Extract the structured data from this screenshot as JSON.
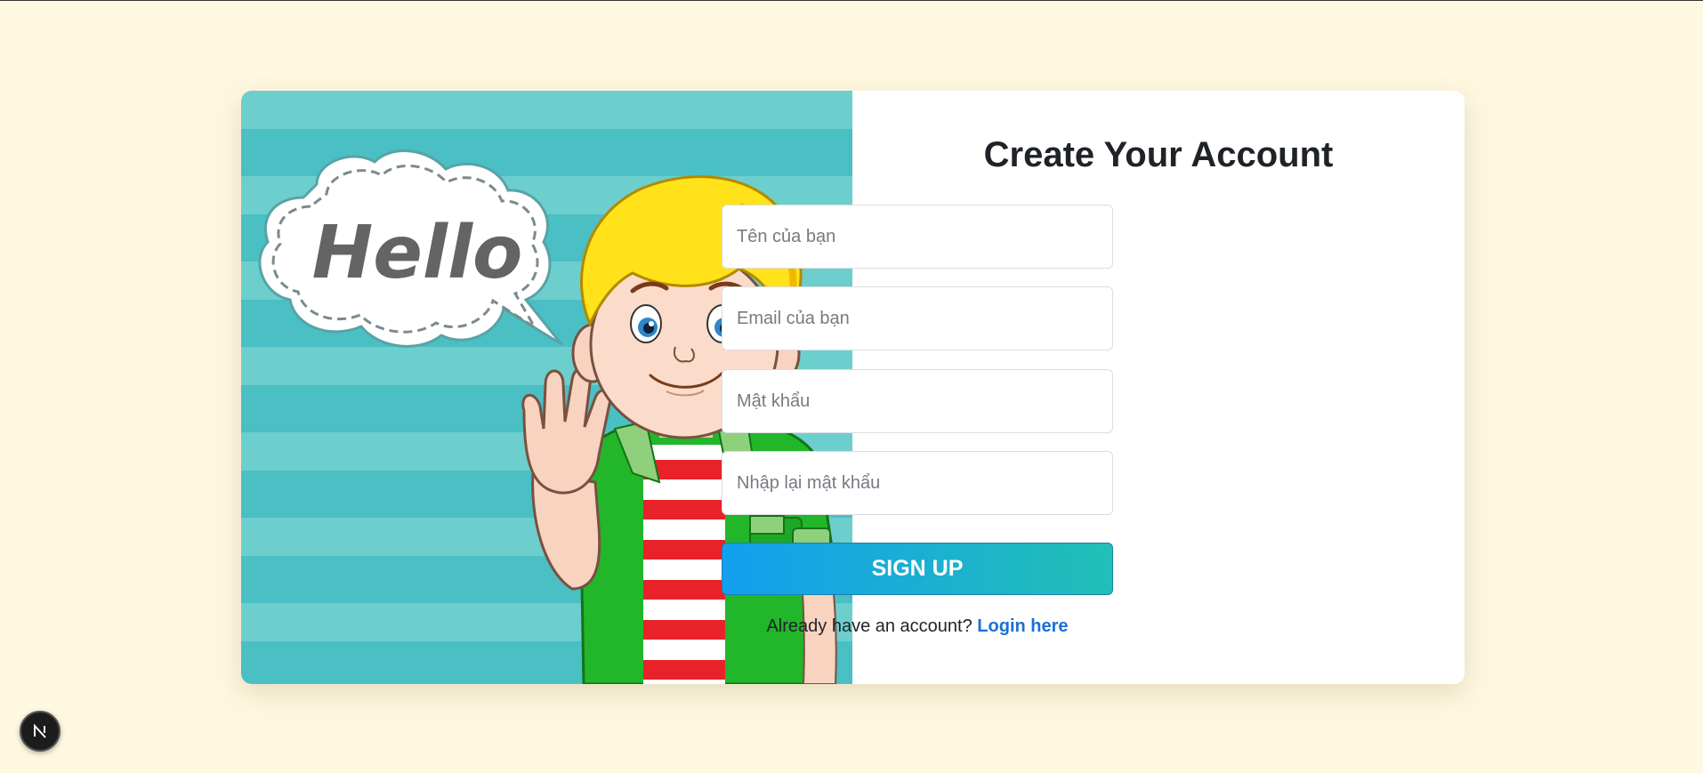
{
  "signup": {
    "title": "Create Your Account",
    "fields": {
      "name_placeholder": "Tên của bạn",
      "email_placeholder": "Email của bạn",
      "password_placeholder": "Mật khẩu",
      "confirm_placeholder": "Nhập lại mật khẩu"
    },
    "button_label": "SIGN UP",
    "login_prompt": "Already have an account?",
    "login_link": "Login here"
  },
  "illustration": {
    "greeting": "Hello"
  },
  "colors": {
    "page_background": "#fef8e0",
    "button_gradient_start": "#129fef",
    "button_gradient_end": "#22bfb6",
    "link": "#1b6fd6",
    "stripe_light": "#6ccfcd",
    "stripe_dark": "#4abfc4"
  },
  "icons": {
    "dev_badge": "nextjs-logo-icon"
  }
}
